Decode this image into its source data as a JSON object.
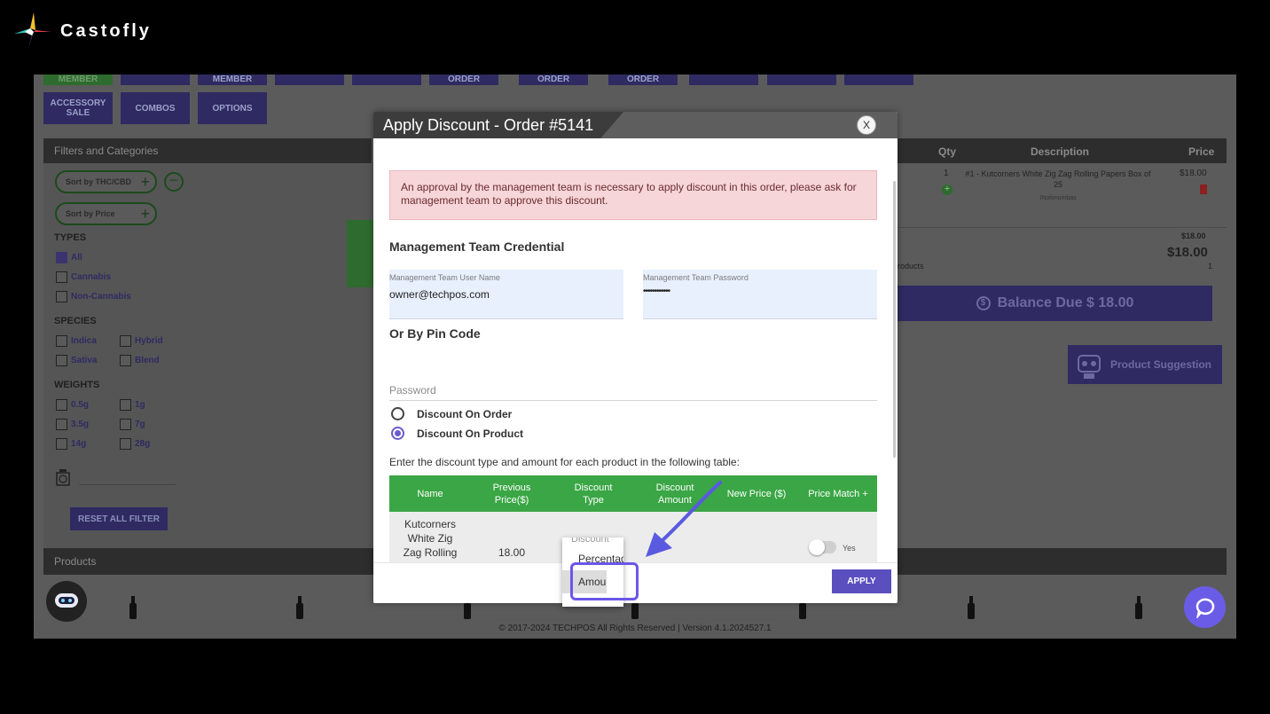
{
  "brand": {
    "name": "Castofly"
  },
  "tiles_row1": [
    "MEMBER",
    "",
    "MEMBER",
    "",
    "",
    "ORDER",
    "ORDER",
    "ORDER",
    "",
    "",
    ""
  ],
  "tiles_row2": [
    "ACCESSORY SALE",
    "COMBOS",
    "OPTIONS"
  ],
  "filters": {
    "header": "Filters and Categories",
    "sort_thc": "Sort by THC/CBD",
    "sort_price": "Sort by Price",
    "types_title": "TYPES",
    "types": [
      {
        "label": "All",
        "checked": true
      },
      {
        "label": "Cannabis",
        "checked": false
      },
      {
        "label": "Non-Cannabis",
        "checked": false
      }
    ],
    "species_title": "SPECIES",
    "species": [
      "Indica",
      "Hybrid",
      "Sativa",
      "Blend"
    ],
    "weights_title": "WEIGHTS",
    "weights": [
      "0.5g",
      "1g",
      "3.5g",
      "7g",
      "14g",
      "28g"
    ],
    "reset": "RESET ALL FILTER"
  },
  "cart": {
    "col_qty": "Qty",
    "col_desc": "Description",
    "col_price": "Price",
    "qty": "1",
    "desc": "#1 - Kutcorners White Zig Zag Rolling Papers Box of 25",
    "desc_sub": "INolonumbas",
    "price": "$18.00",
    "subtotal_small": "$18.00",
    "subtotal_big": "$18.00",
    "products_label": "roducts",
    "products_count": "1",
    "balance_due": "Balance Due $ 18.00",
    "product_suggestion": "Product Suggestion"
  },
  "products_bar": "Products",
  "footer": "© 2017-2024 TECHPOS All Rights Reserved | Version 4.1.2024527.1",
  "modal": {
    "title": "Apply Discount - Order #5141",
    "close": "X",
    "alert": "An approval by the management team is necessary to apply discount in this order, please ask for management team to approve this discount.",
    "cred_title": "Management Team Credential",
    "user_label": "Management Team User Name",
    "user_value": "owner@techpos.com",
    "pass_label": "Management Team Password",
    "pass_value": "••••••••••••",
    "pin_title": "Or By Pin Code",
    "pin_placeholder": "Password",
    "radio_order": "Discount On Order",
    "radio_product": "Discount On Product",
    "instructions": "Enter the discount type and amount for each product in the following table:",
    "table": {
      "headers": [
        "Name",
        "Previous Price($)",
        "Discount Type",
        "Discount Amount",
        "New Price ($)",
        "Price Match +"
      ],
      "row": {
        "name": "Kutcorners White Zig Zag Rolling",
        "prev_price": "18.00",
        "toggle_label": "Yes"
      }
    },
    "apply": "APPLY"
  },
  "dropdown": {
    "ghost": "Discount",
    "options": [
      "Percentage",
      "Amount"
    ],
    "selected": "Amount"
  },
  "colors": {
    "accent": "#6a57e8",
    "table_header": "#3aa645",
    "apply": "#5b4fbf"
  }
}
